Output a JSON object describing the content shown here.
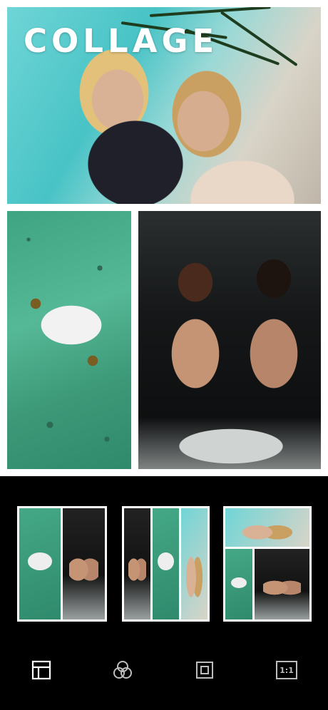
{
  "collage": {
    "title": "COLLAGE"
  },
  "photos": [
    {
      "name": "two-women-poolside-photo"
    },
    {
      "name": "pool-float-aerial-photo"
    },
    {
      "name": "women-in-car-trunk-photo"
    }
  ],
  "layouts": [
    {
      "name": "layout-two-columns",
      "selected": false
    },
    {
      "name": "layout-three-strips",
      "selected": false
    },
    {
      "name": "layout-top-banner-two-bottom",
      "selected": true
    }
  ],
  "toolbar": {
    "items": [
      {
        "icon": "layout-icon",
        "active": true
      },
      {
        "icon": "filters-icon",
        "active": false
      },
      {
        "icon": "border-icon",
        "active": false
      },
      {
        "icon": "aspect-ratio-icon",
        "active": false
      }
    ],
    "ratio_label": "1:1"
  },
  "colors": {
    "background": "#000000",
    "canvas": "#ffffff",
    "icon": "#bdbdbd",
    "icon_active": "#ffffff"
  }
}
